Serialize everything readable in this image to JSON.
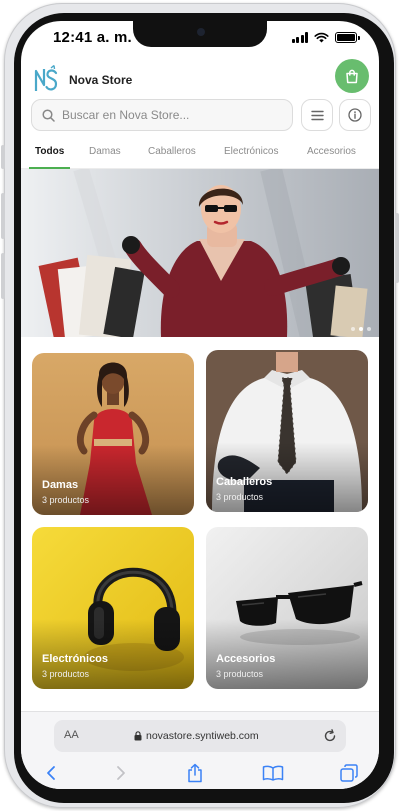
{
  "status_bar": {
    "time": "12:41 a. m."
  },
  "header": {
    "store_name": "Nova Store",
    "logo_letters": "NS"
  },
  "search": {
    "placeholder": "Buscar en Nova Store..."
  },
  "tabs": [
    {
      "label": "Todos",
      "active": true
    },
    {
      "label": "Damas",
      "active": false
    },
    {
      "label": "Caballeros",
      "active": false
    },
    {
      "label": "Electrónicos",
      "active": false
    },
    {
      "label": "Accesorios",
      "active": false
    }
  ],
  "hero": {
    "slides": 3,
    "active_slide": 2
  },
  "categories": [
    {
      "title": "Damas",
      "count": "3 productos"
    },
    {
      "title": "Caballeros",
      "count": "3 productos"
    },
    {
      "title": "Electrónicos",
      "count": "3 productos"
    },
    {
      "title": "Accesorios",
      "count": "3 productos"
    }
  ],
  "browser": {
    "text_size_label": "AA",
    "url": "novastore.syntiweb.com"
  },
  "colors": {
    "accent": "#4caf50",
    "cart_button": "#68bd6e",
    "logo": "#4aa8c9"
  },
  "icons": [
    "shopping-bag-icon",
    "search-icon",
    "menu-icon",
    "info-icon",
    "lock-icon",
    "reload-icon",
    "back-icon",
    "forward-icon",
    "share-icon",
    "bookmarks-icon",
    "tabs-icon"
  ]
}
